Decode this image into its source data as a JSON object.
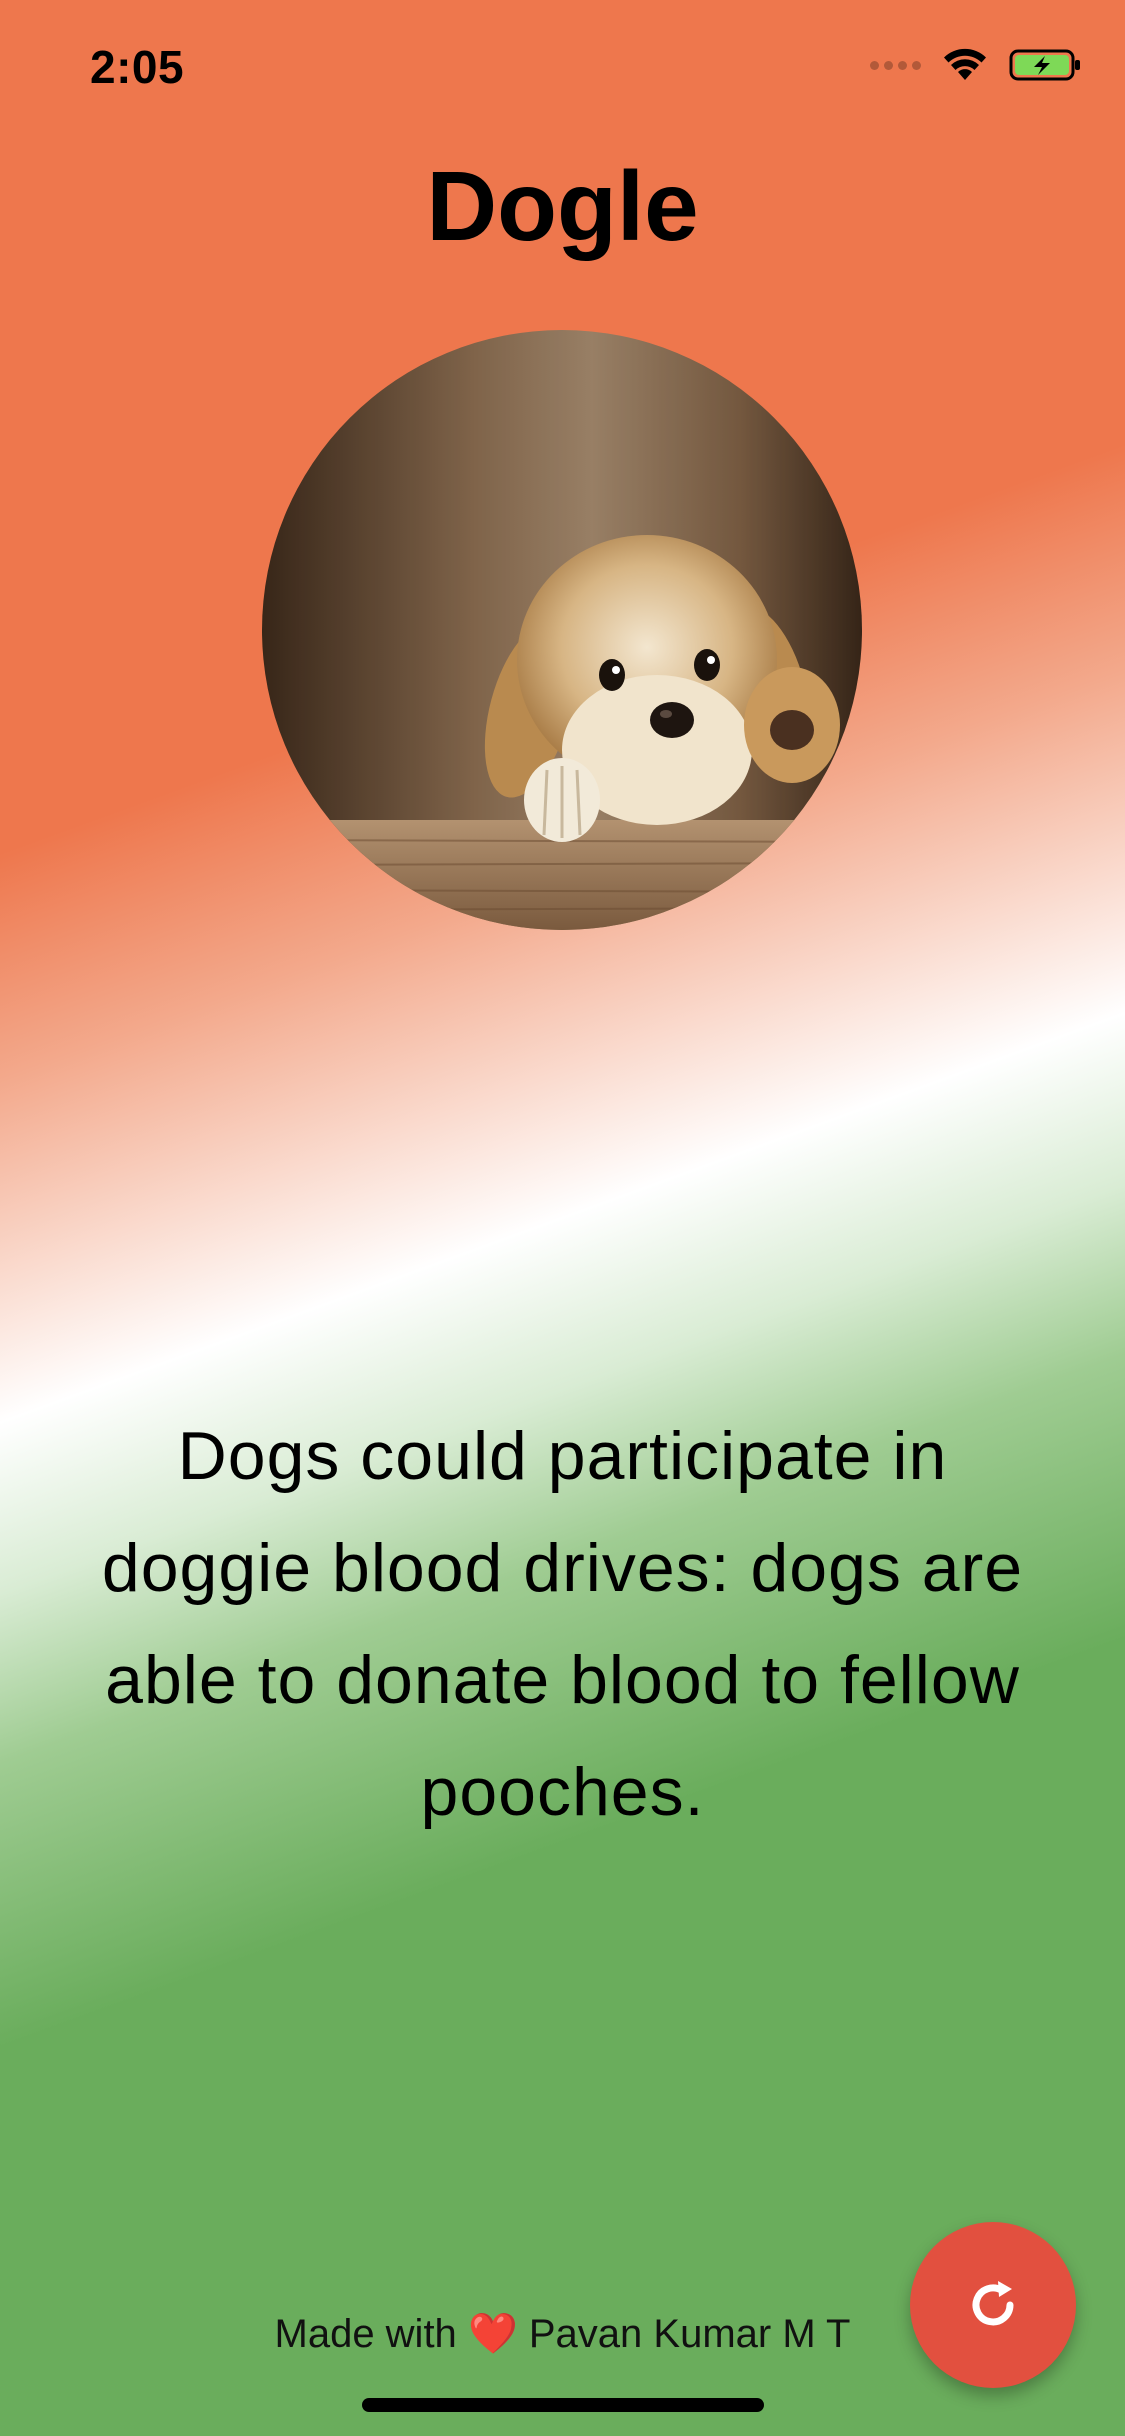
{
  "status_bar": {
    "time": "2:05",
    "icons": [
      "signal-icon",
      "wifi-icon",
      "battery-charging-icon"
    ]
  },
  "header": {
    "title": "Dogle"
  },
  "main": {
    "image_icon": "puppy-photo",
    "fact": "Dogs could participate in doggie blood drives: dogs are able to donate blood to fellow pooches."
  },
  "footer": {
    "credit_prefix": "Made with",
    "heart": "❤️",
    "credit_author": "Pavan Kumar M T",
    "refresh_icon": "refresh-icon"
  },
  "colors": {
    "top_gradient": "#ee774d",
    "middle_gradient": "#ffffff",
    "bottom_gradient": "#6aad5c",
    "fab": "#e2503f"
  }
}
